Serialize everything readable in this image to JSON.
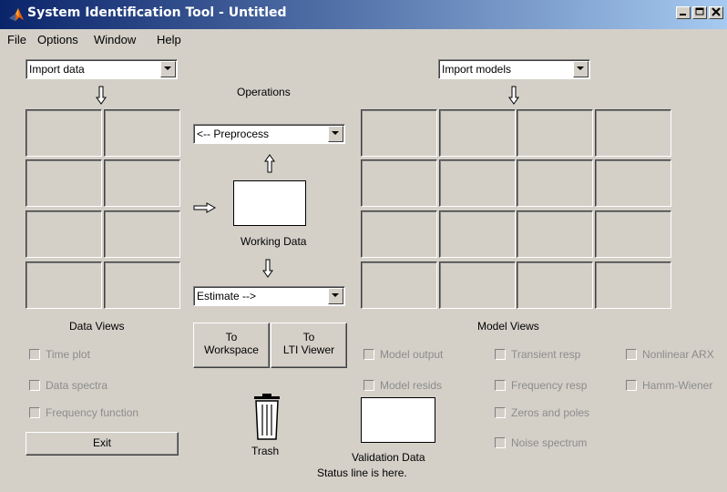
{
  "window": {
    "title": "System Identification Tool - Untitled"
  },
  "menu": [
    "File",
    "Options",
    "Window",
    "Help"
  ],
  "import_data": {
    "value": "Import data"
  },
  "import_models": {
    "value": "Import models"
  },
  "operations": {
    "heading": "Operations",
    "preprocess": "<-- Preprocess",
    "working_data": "Working Data",
    "estimate": "Estimate -->"
  },
  "labels": {
    "data_views": "Data Views",
    "model_views": "Model Views",
    "trash": "Trash",
    "validation_data": "Validation Data",
    "status": "Status line is here."
  },
  "buttons": {
    "to_workspace": [
      "To",
      "Workspace"
    ],
    "to_lti": [
      "To",
      "LTI Viewer"
    ],
    "exit": "Exit"
  },
  "data_views": [
    "Time plot",
    "Data spectra",
    "Frequency function"
  ],
  "model_views_col1": [
    "Model output",
    "Model resids"
  ],
  "model_views_col2": [
    "Transient resp",
    "Frequency resp",
    "Zeros and poles",
    "Noise spectrum"
  ],
  "model_views_col3": [
    "Nonlinear ARX",
    "Hamm-Wiener"
  ]
}
